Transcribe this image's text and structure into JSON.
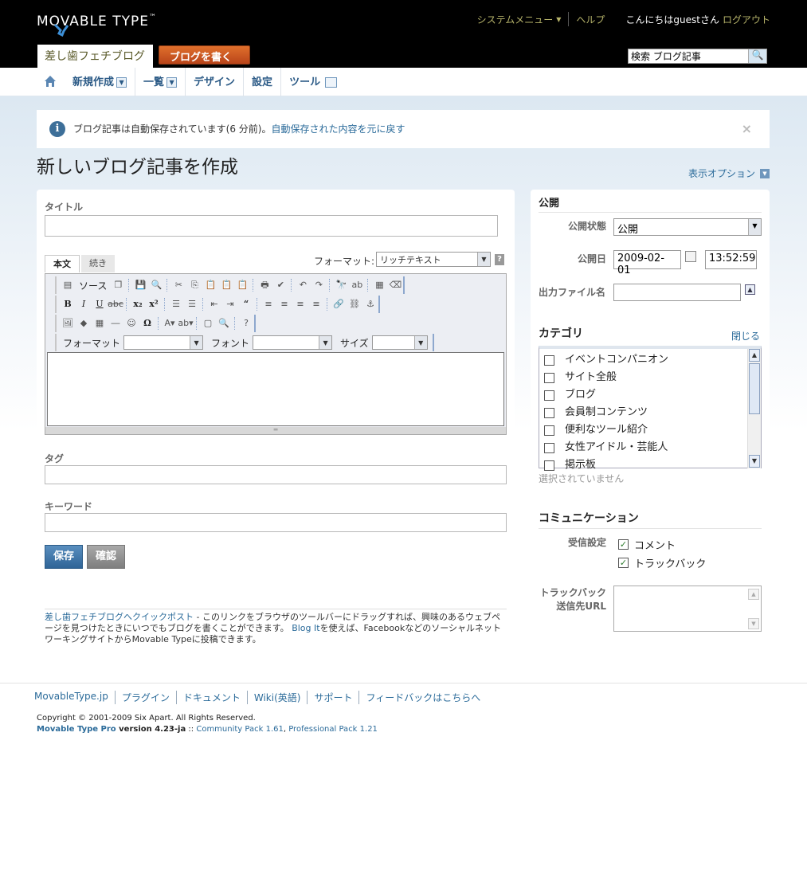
{
  "header": {
    "logo_text": "MOVABLE TYPE",
    "logo_tm": "™",
    "system_menu": "システムメニュー",
    "help": "ヘルプ",
    "greeting": "こんにちはguestさん",
    "logout": "ログアウト",
    "blog_name": "差し歯フェチブログ",
    "write_button": "ブログを書く",
    "search_value": "検索 ブログ記事"
  },
  "nav": {
    "items": [
      "新規作成",
      "一覧",
      "デザイン",
      "設定",
      "ツール"
    ]
  },
  "message": {
    "text": "ブログ記事は自動保存されています(6 分前)。",
    "link": "自動保存された内容を元に戻す"
  },
  "page": {
    "title": "新しいブログ記事を作成",
    "display_options": "表示オプション"
  },
  "editor": {
    "title_label": "タイトル",
    "title_value": "",
    "tab_body": "本文",
    "tab_more": "続き",
    "format_label": "フォーマット:",
    "format_value": "リッチテキスト",
    "source_label": "ソース",
    "format_dd_label": "フォーマット",
    "font_dd_label": "フォント",
    "size_dd_label": "サイズ",
    "tags_label": "タグ",
    "keywords_label": "キーワード",
    "save": "保存",
    "preview": "確認"
  },
  "quickpost": {
    "link": "差し歯フェチブログへクイックポスト",
    "text1": " - このリンクをブラウザのツールバーにドラッグすれば、興味のあるウェブページを見つけたときにいつでもブログを書くことができます。 ",
    "blogit": "Blog It",
    "text2": "を使えば、FacebookなどのソーシャルネットワーキングサイトからMovable Typeに投稿できます。"
  },
  "publish": {
    "heading": "公開",
    "status_label": "公開状態",
    "status_value": "公開",
    "date_label": "公開日",
    "date_value": "2009-02-01",
    "time_value": "13:52:59",
    "outfile_label": "出力ファイル名"
  },
  "category": {
    "heading": "カテゴリ",
    "close": "閉じる",
    "items": [
      "イベントコンパニオン",
      "サイト全般",
      "ブログ",
      "会員制コンテンツ",
      "便利なツール紹介",
      "女性アイドル・芸能人",
      "掲示板"
    ],
    "none_selected": "選択されていません"
  },
  "communication": {
    "heading": "コミュニケーション",
    "receive_label": "受信設定",
    "comment": "コメント",
    "trackback": "トラックバック",
    "tb_url_label_1": "トラックバック",
    "tb_url_label_2": "送信先URL"
  },
  "footer": {
    "links": [
      "MovableType.jp",
      "プラグイン",
      "ドキュメント",
      "Wiki(英語)",
      "サポート",
      "フィードバックはこちらへ"
    ],
    "copyright": "Copyright © 2001-2009 Six Apart. All Rights Reserved.",
    "product": "Movable Type Pro",
    "version": " version 4.23-ja",
    "sep": " :: ",
    "community": "Community Pack 1.61",
    "comma": ", ",
    "professional": "Professional Pack 1.21"
  },
  "colors": {
    "header_bg": "#000000",
    "accent_olive": "#b6b36a",
    "write_button": "#d05a22",
    "link": "#2b6b9a",
    "save_button": "#3a6fa1"
  }
}
